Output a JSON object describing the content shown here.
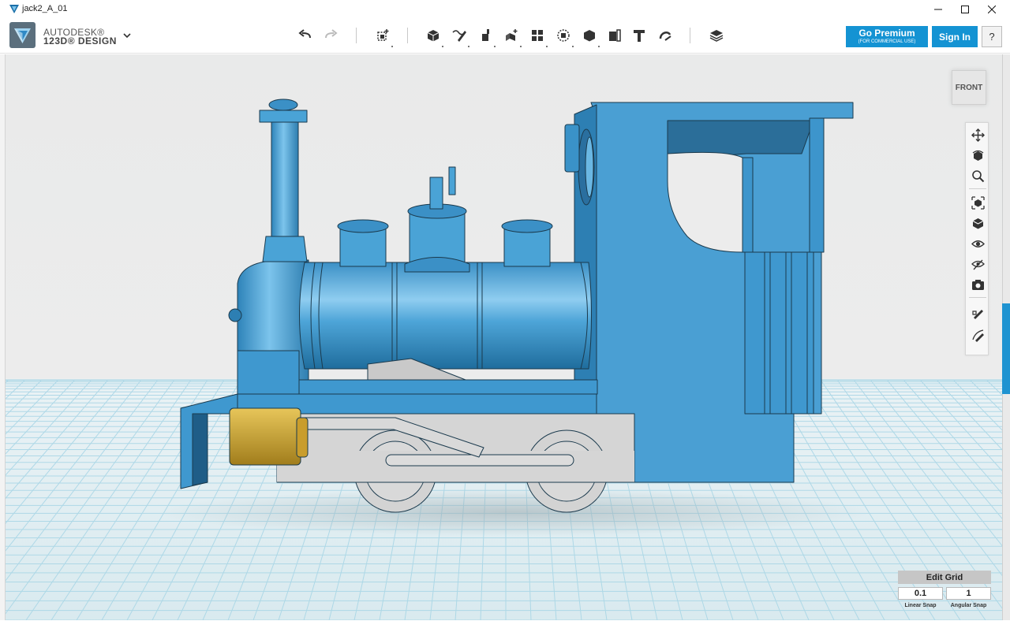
{
  "window": {
    "title": "jack2_A_01"
  },
  "brand": {
    "line1": "AUTODESK®",
    "line2": "123D® DESIGN"
  },
  "toolbar": {
    "tools": [
      {
        "name": "undo-icon"
      },
      {
        "name": "redo-icon"
      },
      {
        "name": "transform-icon"
      },
      {
        "name": "primitives-icon"
      },
      {
        "name": "sketch-icon"
      },
      {
        "name": "construct-icon"
      },
      {
        "name": "modify-icon"
      },
      {
        "name": "pattern-icon"
      },
      {
        "name": "grouping-icon"
      },
      {
        "name": "combine-icon"
      },
      {
        "name": "measure-icon"
      },
      {
        "name": "text-icon"
      },
      {
        "name": "snap-icon"
      },
      {
        "name": "material-icon"
      }
    ],
    "premium_label": "Go Premium",
    "premium_sub": "(FOR COMMERCIAL USE)",
    "signin_label": "Sign In",
    "help_label": "?"
  },
  "viewcube": {
    "face": "FRONT"
  },
  "navbar": {
    "items": [
      "pan-icon",
      "orbit-icon",
      "zoom-icon",
      "fit-icon",
      "view-icon",
      "visibility-icon",
      "materials-outlines-icon",
      "screenshot-icon",
      "edit-icon",
      "edit-mode-icon"
    ]
  },
  "grid": {
    "edit_label": "Edit Grid",
    "linear_snap_value": "0.1",
    "linear_snap_label": "Linear Snap",
    "angular_snap_value": "1",
    "angular_snap_label": "Angular Snap"
  },
  "colors": {
    "accent": "#1493d3",
    "model": "#4aa3d6",
    "model_dark": "#2d7fb3",
    "chassis": "#d5d5d5",
    "brass": "#d4ac3a"
  }
}
